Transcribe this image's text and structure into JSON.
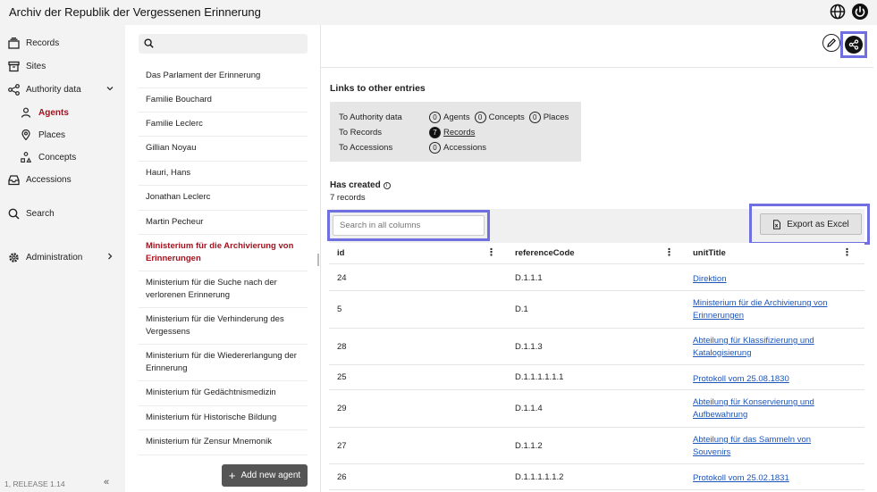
{
  "app": {
    "title": "Archiv der Republik der Vergessenen Erinnerung"
  },
  "sidebar": {
    "items": [
      {
        "label": "Records",
        "icon": "records-icon"
      },
      {
        "label": "Sites",
        "icon": "sites-icon"
      },
      {
        "label": "Authority data",
        "icon": "share-nodes-icon"
      },
      {
        "label": "Agents",
        "icon": "person-icon"
      },
      {
        "label": "Places",
        "icon": "map-pin-icon"
      },
      {
        "label": "Concepts",
        "icon": "concepts-icon"
      },
      {
        "label": "Accessions",
        "icon": "inbox-icon"
      },
      {
        "label": "Search",
        "icon": "search-icon"
      },
      {
        "label": "Administration",
        "icon": "gear-icon"
      }
    ],
    "release": "1, RELEASE 1.14",
    "collapse": "«"
  },
  "agents_list": {
    "items": [
      "Das Parlament der Erinnerung",
      "Familie Bouchard",
      "Familie Leclerc",
      "Gillian Noyau",
      "Hauri, Hans",
      "Jonathan Leclerc",
      "Martin Pecheur",
      "Ministerium für die Archivierung von Erinnerungen",
      "Ministerium für die Suche nach der verlorenen Erinnerung",
      "Ministerium für die Verhinderung des Vergessens",
      "Ministerium für die Wiedererlangung der Erinnerung",
      "Ministerium für Gedächtnismedizin",
      "Ministerium für Historische Bildung",
      "Ministerium für Zensur Mnemonik"
    ],
    "active_index": 7,
    "add_button": "Add new agent",
    "add_symbol": "+"
  },
  "detail": {
    "links_title": "Links to other entries",
    "links": {
      "authority_label": "To Authority data",
      "authority": [
        {
          "count": "0",
          "label": "Agents"
        },
        {
          "count": "0",
          "label": "Concepts"
        },
        {
          "count": "0",
          "label": "Places"
        }
      ],
      "records_label": "To Records",
      "records_count": "7",
      "records_link": "Records",
      "accessions_label": "To Accessions",
      "accessions_count": "0",
      "accessions_text": "Accessions"
    },
    "has_created_title": "Has created",
    "info_mark": "i",
    "has_created_count": "7 records",
    "table_search_placeholder": "Search in all columns",
    "export_label": "Export as Excel",
    "columns": [
      "id",
      "referenceCode",
      "unitTitle"
    ],
    "column_menu_symbol": "⋮",
    "rows": [
      {
        "id": "24",
        "ref": "D.1.1.1",
        "title": "Direktion"
      },
      {
        "id": "5",
        "ref": "D.1",
        "title": "Ministerium für die Archivierung von Erinnerungen"
      },
      {
        "id": "28",
        "ref": "D.1.1.3",
        "title": "Abteilung für Klassifizierung und Katalogisierung"
      },
      {
        "id": "25",
        "ref": "D.1.1.1.1.1.1",
        "title": "Protokoll vom 25.08.1830"
      },
      {
        "id": "29",
        "ref": "D.1.1.4",
        "title": "Abteilung für Konservierung und Aufbewahrung"
      },
      {
        "id": "27",
        "ref": "D.1.1.2",
        "title": "Abteilung für das Sammeln von Souvenirs"
      },
      {
        "id": "26",
        "ref": "D.1.1.1.1.1.2",
        "title": "Protokoll vom 25.02.1831"
      }
    ]
  }
}
